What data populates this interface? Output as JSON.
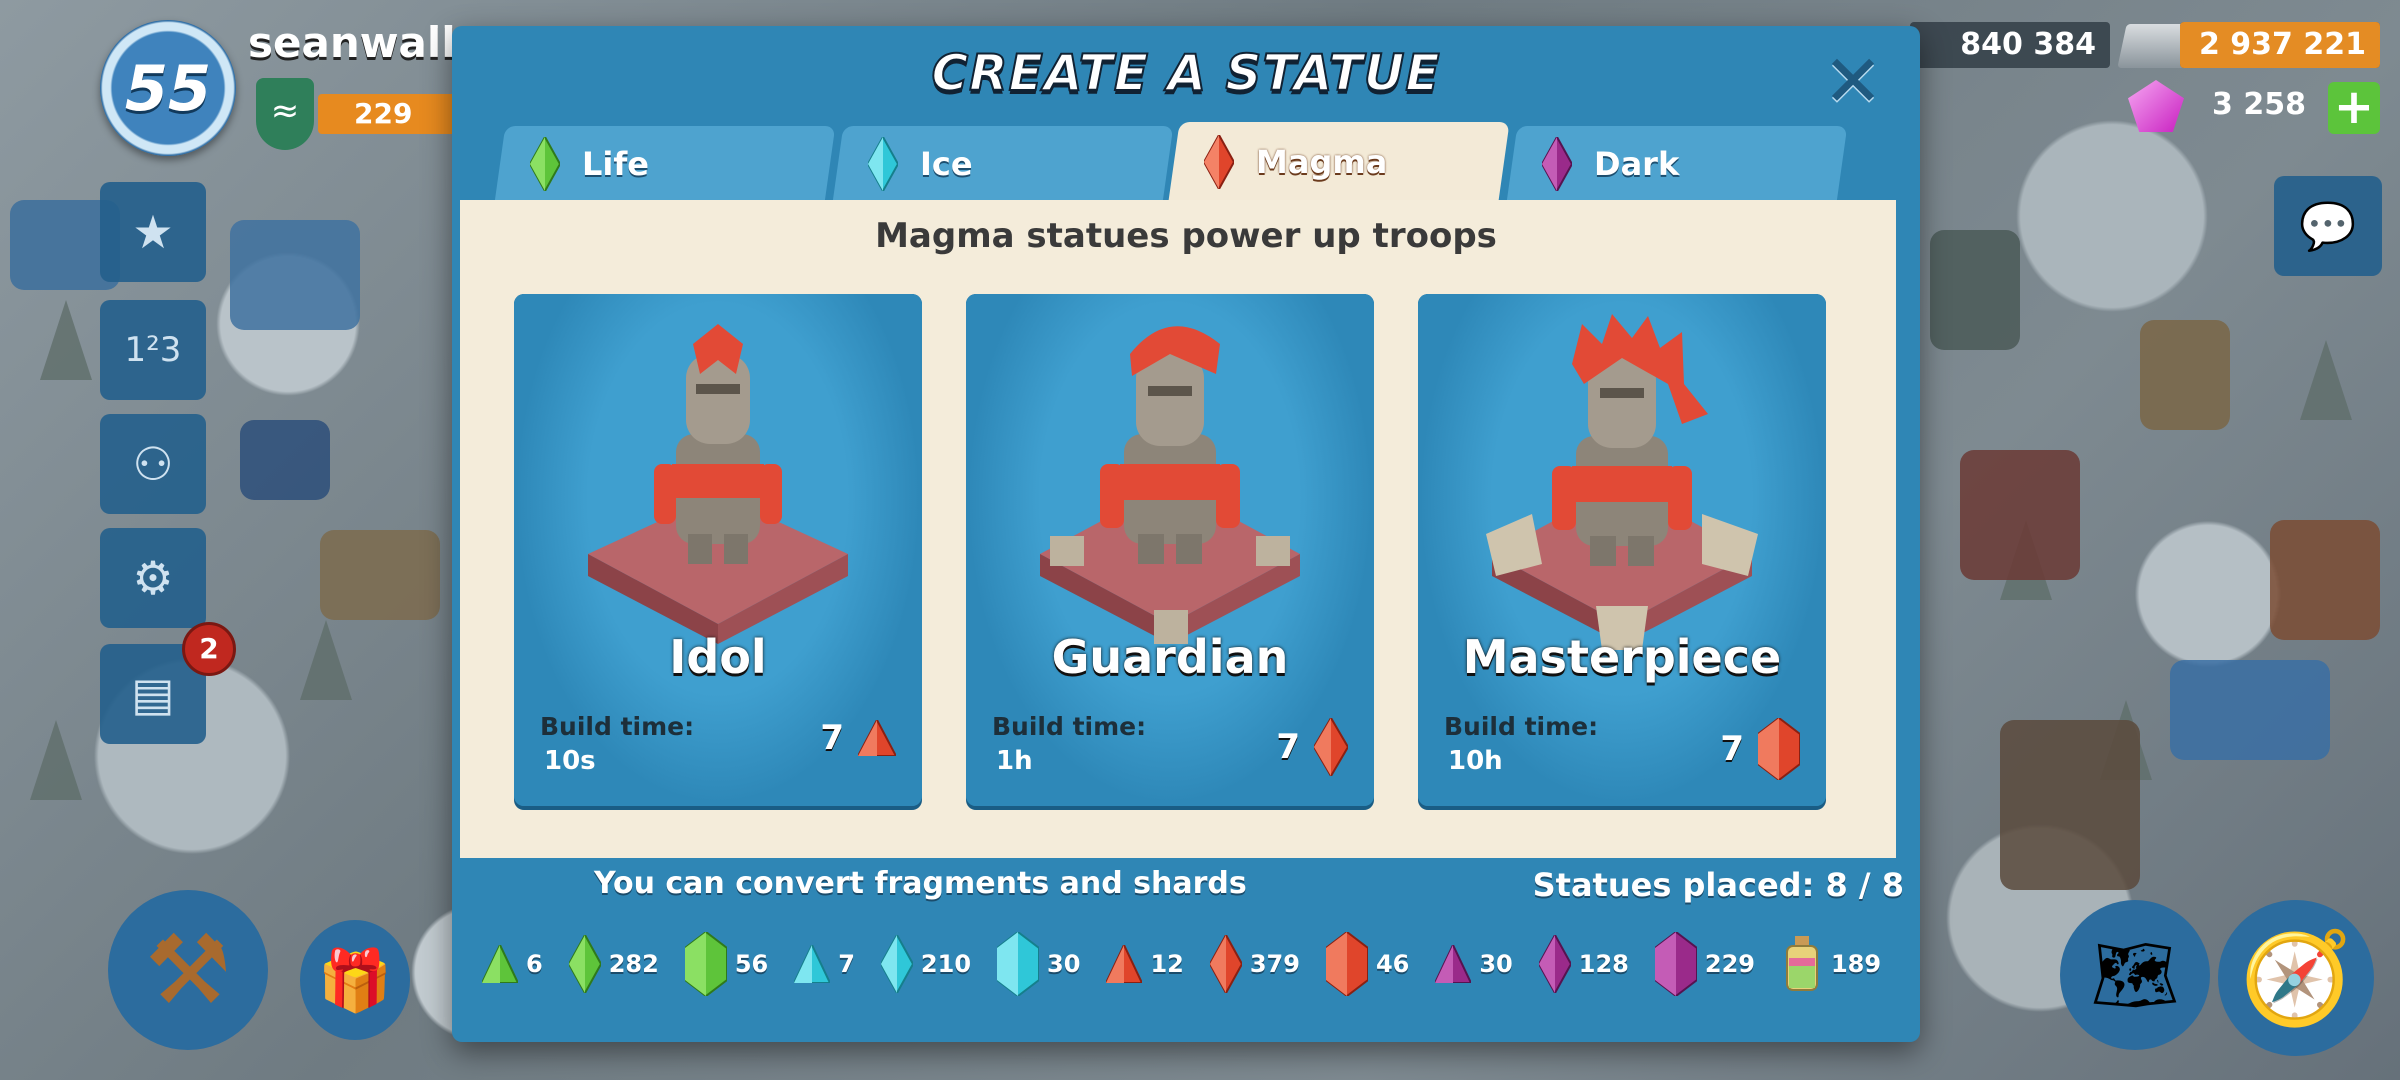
{
  "player": {
    "level": "55",
    "name": "seanwalla",
    "xp_value": "229"
  },
  "resources": {
    "stone": "840 384",
    "iron": "2 937 221",
    "diamonds": "3 258"
  },
  "notifications": {
    "reports_count": "2"
  },
  "dialog": {
    "title": "CREATE A STATUE",
    "close_label": "✕",
    "tabs": [
      {
        "label": "Life",
        "color": "#5ec43a"
      },
      {
        "label": "Ice",
        "color": "#2fc7d8"
      },
      {
        "label": "Magma",
        "color": "#e0452b"
      },
      {
        "label": "Dark",
        "color": "#9a2a8a"
      }
    ],
    "active_tab": "Magma",
    "subtitle": "Magma statues power up troops",
    "statues": [
      {
        "name": "Idol",
        "build_label": "Build time:",
        "build_time": "10s",
        "cost": "7",
        "cost_icon": "magma-fragment-icon"
      },
      {
        "name": "Guardian",
        "build_label": "Build time:",
        "build_time": "1h",
        "cost": "7",
        "cost_icon": "magma-shard-icon"
      },
      {
        "name": "Masterpiece",
        "build_label": "Build time:",
        "build_time": "10h",
        "cost": "7",
        "cost_icon": "magma-crystal-icon"
      }
    ],
    "convert_text": "You can convert fragments and shards",
    "statues_placed": "Statues placed: 8 / 8",
    "inventory": [
      {
        "icon": "life-fragment-icon",
        "count": "6",
        "color": "#5ec43a"
      },
      {
        "icon": "life-shard-icon",
        "count": "282",
        "color": "#5ec43a"
      },
      {
        "icon": "life-crystal-icon",
        "count": "56",
        "color": "#5ec43a"
      },
      {
        "icon": "ice-fragment-icon",
        "count": "7",
        "color": "#2fc7d8"
      },
      {
        "icon": "ice-shard-icon",
        "count": "210",
        "color": "#2fc7d8"
      },
      {
        "icon": "ice-crystal-icon",
        "count": "30",
        "color": "#2fc7d8"
      },
      {
        "icon": "magma-fragment-icon",
        "count": "12",
        "color": "#e0452b"
      },
      {
        "icon": "magma-shard-icon",
        "count": "379",
        "color": "#e0452b"
      },
      {
        "icon": "magma-crystal-icon",
        "count": "46",
        "color": "#e0452b"
      },
      {
        "icon": "dark-fragment-icon",
        "count": "30",
        "color": "#9a2a8a"
      },
      {
        "icon": "dark-shard-icon",
        "count": "128",
        "color": "#9a2a8a"
      },
      {
        "icon": "dark-crystal-icon",
        "count": "229",
        "color": "#9a2a8a"
      },
      {
        "icon": "powder-bottle-icon",
        "count": "189",
        "color": "#e8d27a"
      }
    ]
  }
}
